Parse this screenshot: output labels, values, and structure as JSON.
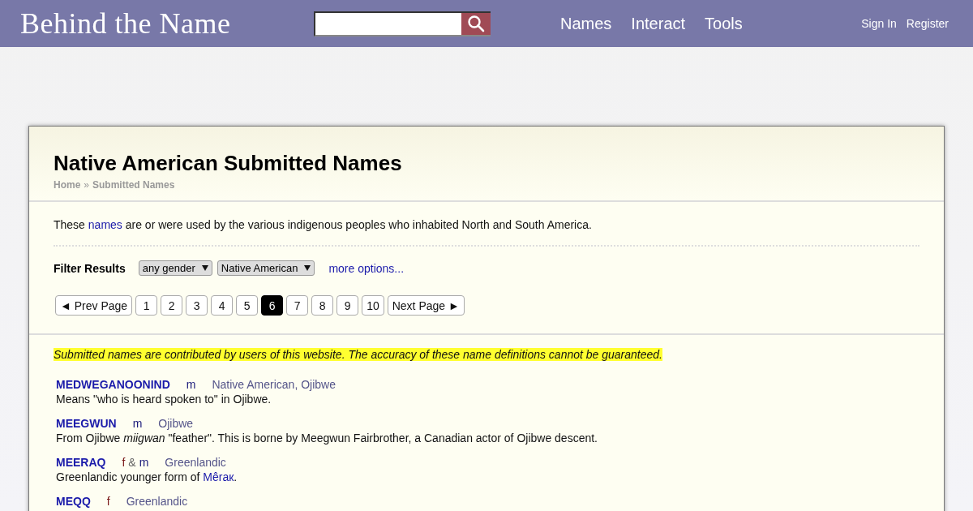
{
  "header": {
    "logo": "Behind the Name",
    "nav": [
      "Names",
      "Interact",
      "Tools"
    ],
    "account": [
      "Sign In",
      "Register"
    ]
  },
  "page": {
    "title": "Native American Submitted Names",
    "breadcrumb": [
      "Home",
      "Submitted Names"
    ],
    "breadcrumb_separator": "»",
    "intro": [
      {
        "kind": "text",
        "text": "These "
      },
      {
        "kind": "link",
        "text": "names"
      },
      {
        "kind": "text",
        "text": " are or were used by the various indigenous peoples who inhabited North and South America."
      }
    ],
    "filter": {
      "label": "Filter Results",
      "selects": [
        "any gender",
        "Native American"
      ],
      "more": "more options..."
    },
    "pagination": [
      {
        "label": "◄ Prev Page",
        "selected": false
      },
      {
        "label": "1",
        "selected": false
      },
      {
        "label": "2",
        "selected": false
      },
      {
        "label": "3",
        "selected": false
      },
      {
        "label": "4",
        "selected": false
      },
      {
        "label": "5",
        "selected": false
      },
      {
        "label": "6",
        "selected": true
      },
      {
        "label": "7",
        "selected": false
      },
      {
        "label": "8",
        "selected": false
      },
      {
        "label": "9",
        "selected": false
      },
      {
        "label": "10",
        "selected": false
      },
      {
        "label": "Next Page ►",
        "selected": false
      }
    ],
    "notice": "Submitted names are contributed by users of this website. The accuracy of these name definitions cannot be guaranteed.",
    "entries": [
      {
        "name": "MEDWEGANOONIND",
        "gender": [
          {
            "kind": "m",
            "text": "m"
          }
        ],
        "usage": "Native American, Ojibwe",
        "description": [
          {
            "kind": "text",
            "text": "Means \"who is heard spoken to\" in Ojibwe."
          }
        ]
      },
      {
        "name": "MEEGWUN",
        "gender": [
          {
            "kind": "m",
            "text": "m"
          }
        ],
        "usage": "Ojibwe",
        "description": [
          {
            "kind": "text",
            "text": "From Ojibwe *miigwan* \"feather\". This is borne by Meegwun Fairbrother, a Canadian actor of Ojibwe descent."
          }
        ]
      },
      {
        "name": "MEERAQ",
        "gender": [
          {
            "kind": "f",
            "text": "f"
          },
          {
            "kind": "and",
            "text": "&"
          },
          {
            "kind": "m",
            "text": "m"
          }
        ],
        "usage": "Greenlandic",
        "description": [
          {
            "kind": "text",
            "text": "Greenlandic younger form of "
          },
          {
            "kind": "link",
            "text": "Mêraк"
          },
          {
            "kind": "text",
            "text": "."
          }
        ]
      },
      {
        "name": "MEQQ",
        "gender": [
          {
            "kind": "f",
            "text": "f"
          }
        ],
        "usage": "Greenlandic"
      }
    ]
  }
}
